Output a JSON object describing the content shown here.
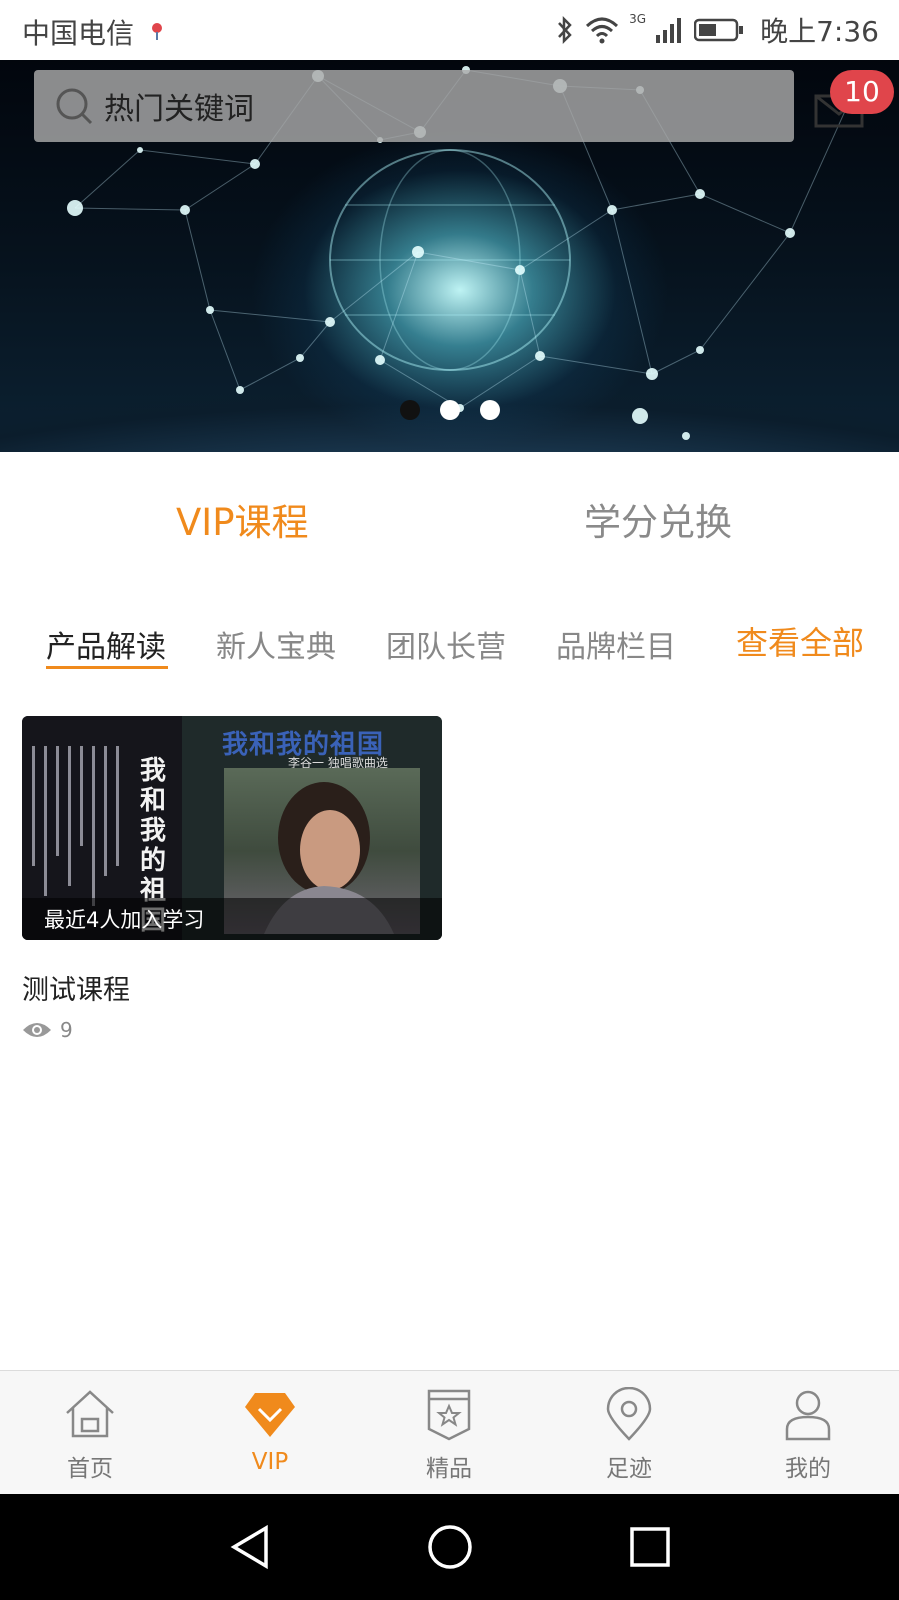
{
  "status_bar": {
    "carrier": "中国电信",
    "network": "3G",
    "time": "晚上7:36"
  },
  "header": {
    "search_placeholder": "热门关键词",
    "mail_badge": "10",
    "banner_pages": 3,
    "banner_active_page": 1
  },
  "main_tabs": [
    {
      "label": "VIP课程",
      "active": true
    },
    {
      "label": "学分兑换",
      "active": false
    }
  ],
  "category_tabs": [
    {
      "label": "产品解读",
      "active": true
    },
    {
      "label": "新人宝典",
      "active": false
    },
    {
      "label": "团队长营",
      "active": false
    },
    {
      "label": "品牌栏目",
      "active": false
    }
  ],
  "view_all": "查看全部",
  "courses": [
    {
      "cover_title": "我和我的祖国",
      "cover_subtitle": "李谷一 独唱歌曲选",
      "overlay": "最近4人加入学习",
      "title": "测试课程",
      "views": "9"
    }
  ],
  "bottom_nav": [
    {
      "label": "首页",
      "icon": "home-icon",
      "active": false
    },
    {
      "label": "VIP",
      "icon": "diamond-icon",
      "active": true
    },
    {
      "label": "精品",
      "icon": "badge-star-icon",
      "active": false
    },
    {
      "label": "足迹",
      "icon": "location-pin-icon",
      "active": false
    },
    {
      "label": "我的",
      "icon": "user-icon",
      "active": false
    }
  ],
  "colors": {
    "accent": "#f08a1c",
    "badge": "#e0454b",
    "inactive_text": "#888888"
  }
}
